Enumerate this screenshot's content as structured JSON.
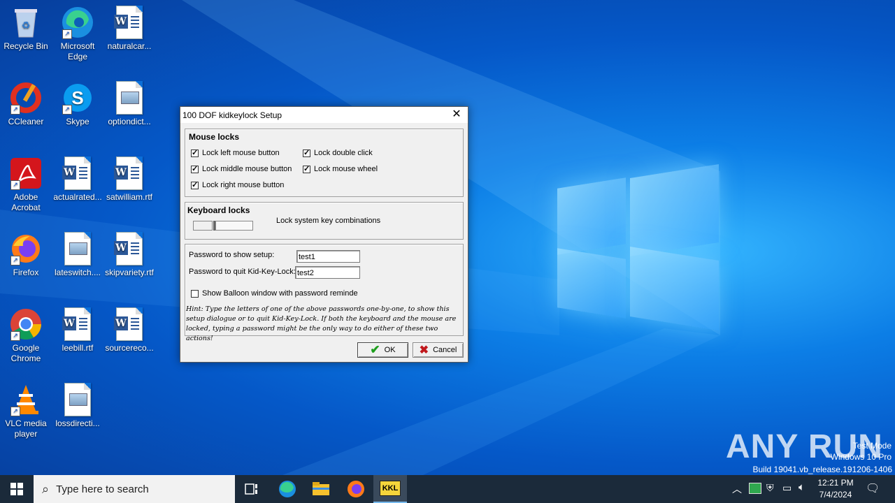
{
  "desktop": {
    "icons": [
      {
        "label": "Recycle Bin"
      },
      {
        "label": "Microsoft Edge"
      },
      {
        "label": "naturalcar..."
      },
      {
        "label": "CCleaner"
      },
      {
        "label": "Skype"
      },
      {
        "label": "optiondict..."
      },
      {
        "label": "Adobe Acrobat"
      },
      {
        "label": "actualrated..."
      },
      {
        "label": "satwilliam.rtf"
      },
      {
        "label": "Firefox"
      },
      {
        "label": "lateswitch...."
      },
      {
        "label": "skipvariety.rtf"
      },
      {
        "label": "Google Chrome"
      },
      {
        "label": "leebill.rtf"
      },
      {
        "label": "sourcereco..."
      },
      {
        "label": "VLC media player"
      },
      {
        "label": "lossdirecti..."
      }
    ]
  },
  "dialog": {
    "title": "100 DOF kidkeylock Setup",
    "close_glyph": "✕",
    "mouse_locks": {
      "title": "Mouse locks",
      "left": "Lock left mouse button",
      "middle": "Lock middle mouse button",
      "right": "Lock right mouse button",
      "double": "Lock double click",
      "wheel": "Lock mouse wheel"
    },
    "keyboard_locks": {
      "title": "Keyboard locks",
      "system_keys": "Lock system key combinations"
    },
    "password": {
      "show_label": "Password to show setup:",
      "show_value": "test1",
      "quit_label": "Password to quit Kid-Key-Lock:",
      "quit_value": "test2",
      "balloon": "Show Balloon window with password reminde",
      "hint": "Hint: Type the letters of one of the above passwords one-by-one, to show this setup dialogue or to quit Kid-Key-Lock. If both the keyboard and the mouse are locked, typing a password might be the only way to do either of these two actions!"
    },
    "ok_label": "OK",
    "cancel_label": "Cancel"
  },
  "taskbar": {
    "search_placeholder": "Type here to search",
    "kkl_label": "KKL",
    "time": "12:21 PM",
    "date": "7/4/2024"
  },
  "watermark": {
    "brand": "ANY RUN",
    "mode": "Test Mode",
    "os": "Windows 10 Pro",
    "build": "Build 19041.vb_release.191206-1406"
  },
  "colors": {
    "desktop": "#0a6fdc",
    "taskbar": "#1b2a3a",
    "ok_check": "#1e9e1e",
    "cancel_x": "#c0181c"
  }
}
